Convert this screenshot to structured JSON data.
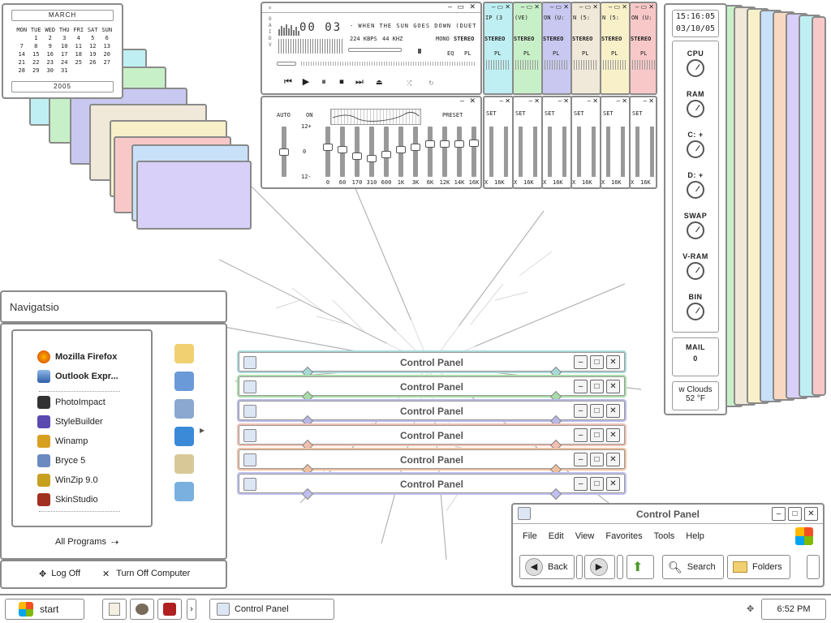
{
  "calendar": {
    "month": "MARCH",
    "year": "2005",
    "weekdays": [
      "MON",
      "TUE",
      "WED",
      "THU",
      "FRI",
      "SAT",
      "SUN"
    ],
    "weeks": [
      [
        "",
        "1",
        "2",
        "3",
        "4",
        "5",
        "6"
      ],
      [
        "7",
        "8",
        "9",
        "10",
        "11",
        "12",
        "13"
      ],
      [
        "14",
        "15",
        "16",
        "17",
        "18",
        "19",
        "20"
      ],
      [
        "21",
        "22",
        "23",
        "24",
        "25",
        "26",
        "27"
      ],
      [
        "28",
        "29",
        "30",
        "31",
        "",
        "",
        ""
      ]
    ]
  },
  "winamp": {
    "time": "00 03",
    "track": "- WHEN THE SUN GOES DOWN (DUET",
    "kbps": "224 KBPS",
    "khz": "44 KHZ",
    "mono": "MONO",
    "stereo": "STEREO",
    "eq_btn": "EQ",
    "pl_btn": "PL",
    "side_letters": "O A I D V",
    "eq_auto": "AUTO",
    "eq_on": "ON",
    "eq_preset": "PRESET",
    "eq_plus": "12+",
    "eq_zero": "0",
    "eq_minus": "12-",
    "eq_bands": [
      "0",
      "60",
      "170",
      "310",
      "600",
      "1K",
      "3K",
      "6K",
      "12K",
      "14K",
      "16K"
    ],
    "eq_levels": [
      0.5,
      0.62,
      0.55,
      0.4,
      0.35,
      0.45,
      0.55,
      0.62,
      0.68,
      0.68,
      0.68,
      0.7
    ]
  },
  "winamp_clones": {
    "titles": [
      "IP (3",
      "(VE)",
      "ON (U:",
      "N (5:",
      "N (5:",
      "ON (U:"
    ],
    "stereo": "STEREO",
    "pl": "PL",
    "set": "SET",
    "band": "16K",
    "x": "X"
  },
  "sysmon": {
    "time": "15:16:05",
    "date": "03/10/05",
    "gauges": [
      "CPU",
      "RAM",
      "C: +",
      "D: +",
      "SWAP",
      "V-RAM",
      "BIN"
    ],
    "mail_label": "MAIL",
    "mail_count": "0",
    "weather_text": "w Clouds",
    "temperature": "52 °F"
  },
  "nav": {
    "title": "Navigatsio",
    "pinned": [
      "Mozilla Firefox",
      "Outlook Expr..."
    ],
    "recent": [
      "PhotoImpact",
      "StyleBuilder",
      "Winamp",
      "Bryce 5",
      "WinZip 9.0",
      "SkinStudio"
    ],
    "all_programs": "All Programs",
    "log_off": "Log Off",
    "turn_off": "Turn Off Computer",
    "right_icons": [
      "folder-icon",
      "network-icon",
      "control-panel-icon",
      "internet-icon",
      "search-icon",
      "run-icon"
    ]
  },
  "control_panels": {
    "title": "Control Panel",
    "accent_colors": [
      "#a8d8d8",
      "#a8dca8",
      "#b8b8e8",
      "#f0c0b0",
      "#f0c0a0",
      "#c0c0f0"
    ]
  },
  "explorer": {
    "title": "Control Panel",
    "menu": [
      "File",
      "Edit",
      "View",
      "Favorites",
      "Tools",
      "Help"
    ],
    "back": "Back",
    "search": "Search",
    "folders": "Folders"
  },
  "taskbar": {
    "start": "start",
    "task": "Control Panel",
    "clock": "6:52 PM",
    "chevron": "›"
  },
  "colors": {
    "pastel_stack": [
      "#bfeff2",
      "#c8f0c8",
      "#c8c8f0",
      "#f0e8d8",
      "#f8f0c8",
      "#f8c8c8",
      "#c8e0f8",
      "#f8d8c0",
      "#d8d0f8"
    ]
  }
}
